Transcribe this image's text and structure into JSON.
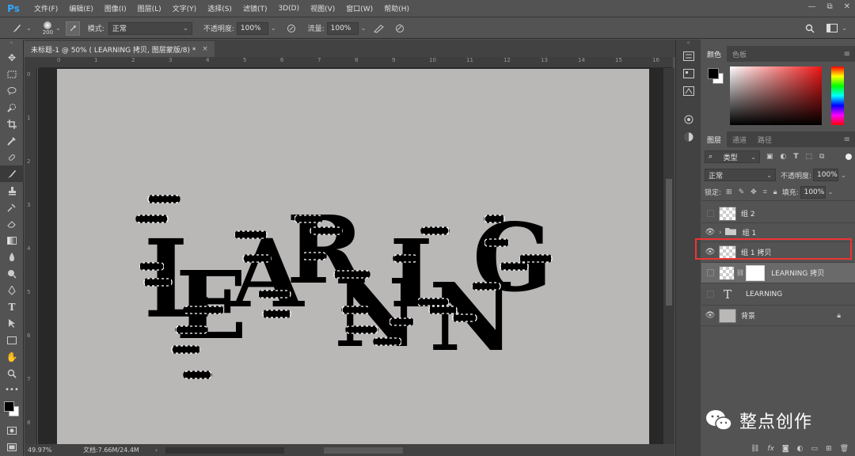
{
  "app": {
    "logo": "Ps"
  },
  "menu": [
    "文件(F)",
    "编辑(E)",
    "图像(I)",
    "图层(L)",
    "文字(Y)",
    "选择(S)",
    "滤镜(T)",
    "3D(D)",
    "视图(V)",
    "窗口(W)",
    "帮助(H)"
  ],
  "window_controls": [
    "—",
    "⧉",
    "✕"
  ],
  "options": {
    "brush_size": "200",
    "mode_label": "模式:",
    "mode_value": "正常",
    "opacity_label": "不透明度:",
    "opacity_value": "100%",
    "flow_label": "流量:",
    "flow_value": "100%"
  },
  "document": {
    "tab_title": "未标题-1 @ 50% ( LEARNING 拷贝, 图层蒙版/8) *",
    "tab_close": "×",
    "zoom": "49.97%",
    "doc_info": "文档:7.66M/24.4M",
    "ruler_h": [
      "0",
      "1",
      "2",
      "3",
      "4",
      "5",
      "6",
      "7",
      "8",
      "9",
      "10",
      "11",
      "12",
      "13",
      "14",
      "15",
      "16"
    ],
    "ruler_v": [
      "0",
      "1",
      "2",
      "3",
      "4",
      "5",
      "6",
      "7",
      "8"
    ],
    "artwork_text": "LEARNING"
  },
  "color_panel": {
    "tabs": [
      "颜色",
      "色板"
    ],
    "fg_color": "#000000",
    "bg_color": "#ffffff"
  },
  "layers_panel": {
    "tabs": [
      "图层",
      "通道",
      "路径"
    ],
    "filter_label": "类型",
    "blend_mode": "正常",
    "opacity_label": "不透明度:",
    "opacity_value": "100%",
    "lock_label": "锁定:",
    "fill_label": "填充:",
    "fill_value": "100%",
    "layers": [
      {
        "name": "组 2",
        "visible": false
      },
      {
        "name": "组 1",
        "visible": true
      },
      {
        "name": "组 1 拷贝",
        "visible": true
      },
      {
        "name": "LEARNING 拷贝",
        "visible": true
      },
      {
        "name": "LEARNING",
        "visible": false
      },
      {
        "name": "背景",
        "visible": true
      }
    ]
  },
  "watermark": {
    "text": "整点创作"
  }
}
